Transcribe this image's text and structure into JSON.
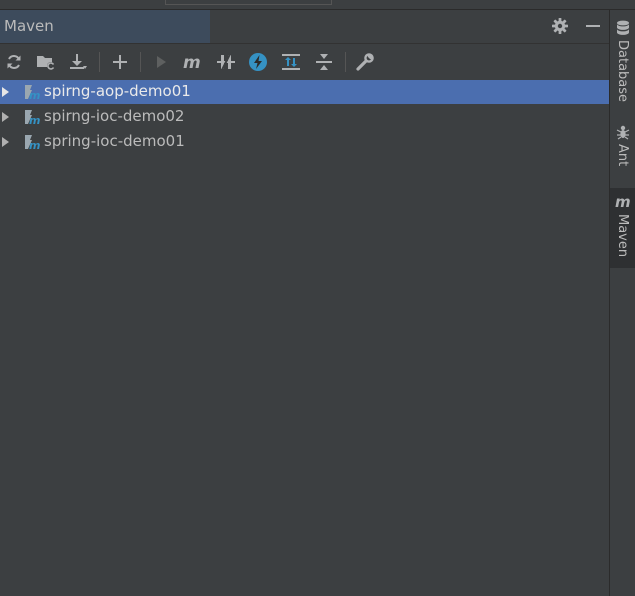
{
  "panel": {
    "title": "Maven"
  },
  "toolbar": {
    "buttons": [
      {
        "name": "reload-all-maven-projects",
        "icon": "refresh-icon"
      },
      {
        "name": "generate-sources",
        "icon": "folder-refresh-icon"
      },
      {
        "name": "download-sources",
        "icon": "download-icon"
      },
      {
        "name": "add-maven-project",
        "icon": "plus-icon"
      },
      {
        "name": "run-maven-build",
        "icon": "play-icon"
      },
      {
        "name": "execute-maven-goal",
        "icon": "maven-m-icon"
      },
      {
        "name": "toggle-offline-mode",
        "icon": "offline-icon"
      },
      {
        "name": "skip-tests-mode",
        "icon": "lightning-icon"
      },
      {
        "name": "show-dependencies",
        "icon": "show-dependencies-icon"
      },
      {
        "name": "collapse-all",
        "icon": "collapse-all-icon"
      },
      {
        "name": "maven-settings",
        "icon": "wrench-icon"
      }
    ]
  },
  "tree": {
    "projects": [
      {
        "label": "spirng-aop-demo01",
        "selected": true
      },
      {
        "label": "spirng-ioc-demo02",
        "selected": false
      },
      {
        "label": "spring-ioc-demo01",
        "selected": false
      }
    ]
  },
  "sidebar": {
    "tabs": [
      {
        "label": "Database",
        "icon": "database-icon"
      },
      {
        "label": "Ant",
        "icon": "ant-icon"
      },
      {
        "label": "Maven",
        "icon": "maven-m-icon",
        "active": true
      }
    ]
  },
  "colors": {
    "background": "#3c3f41",
    "selection": "#4b6eaf",
    "text": "#bbbbbb",
    "accent_blue": "#3592c4"
  }
}
